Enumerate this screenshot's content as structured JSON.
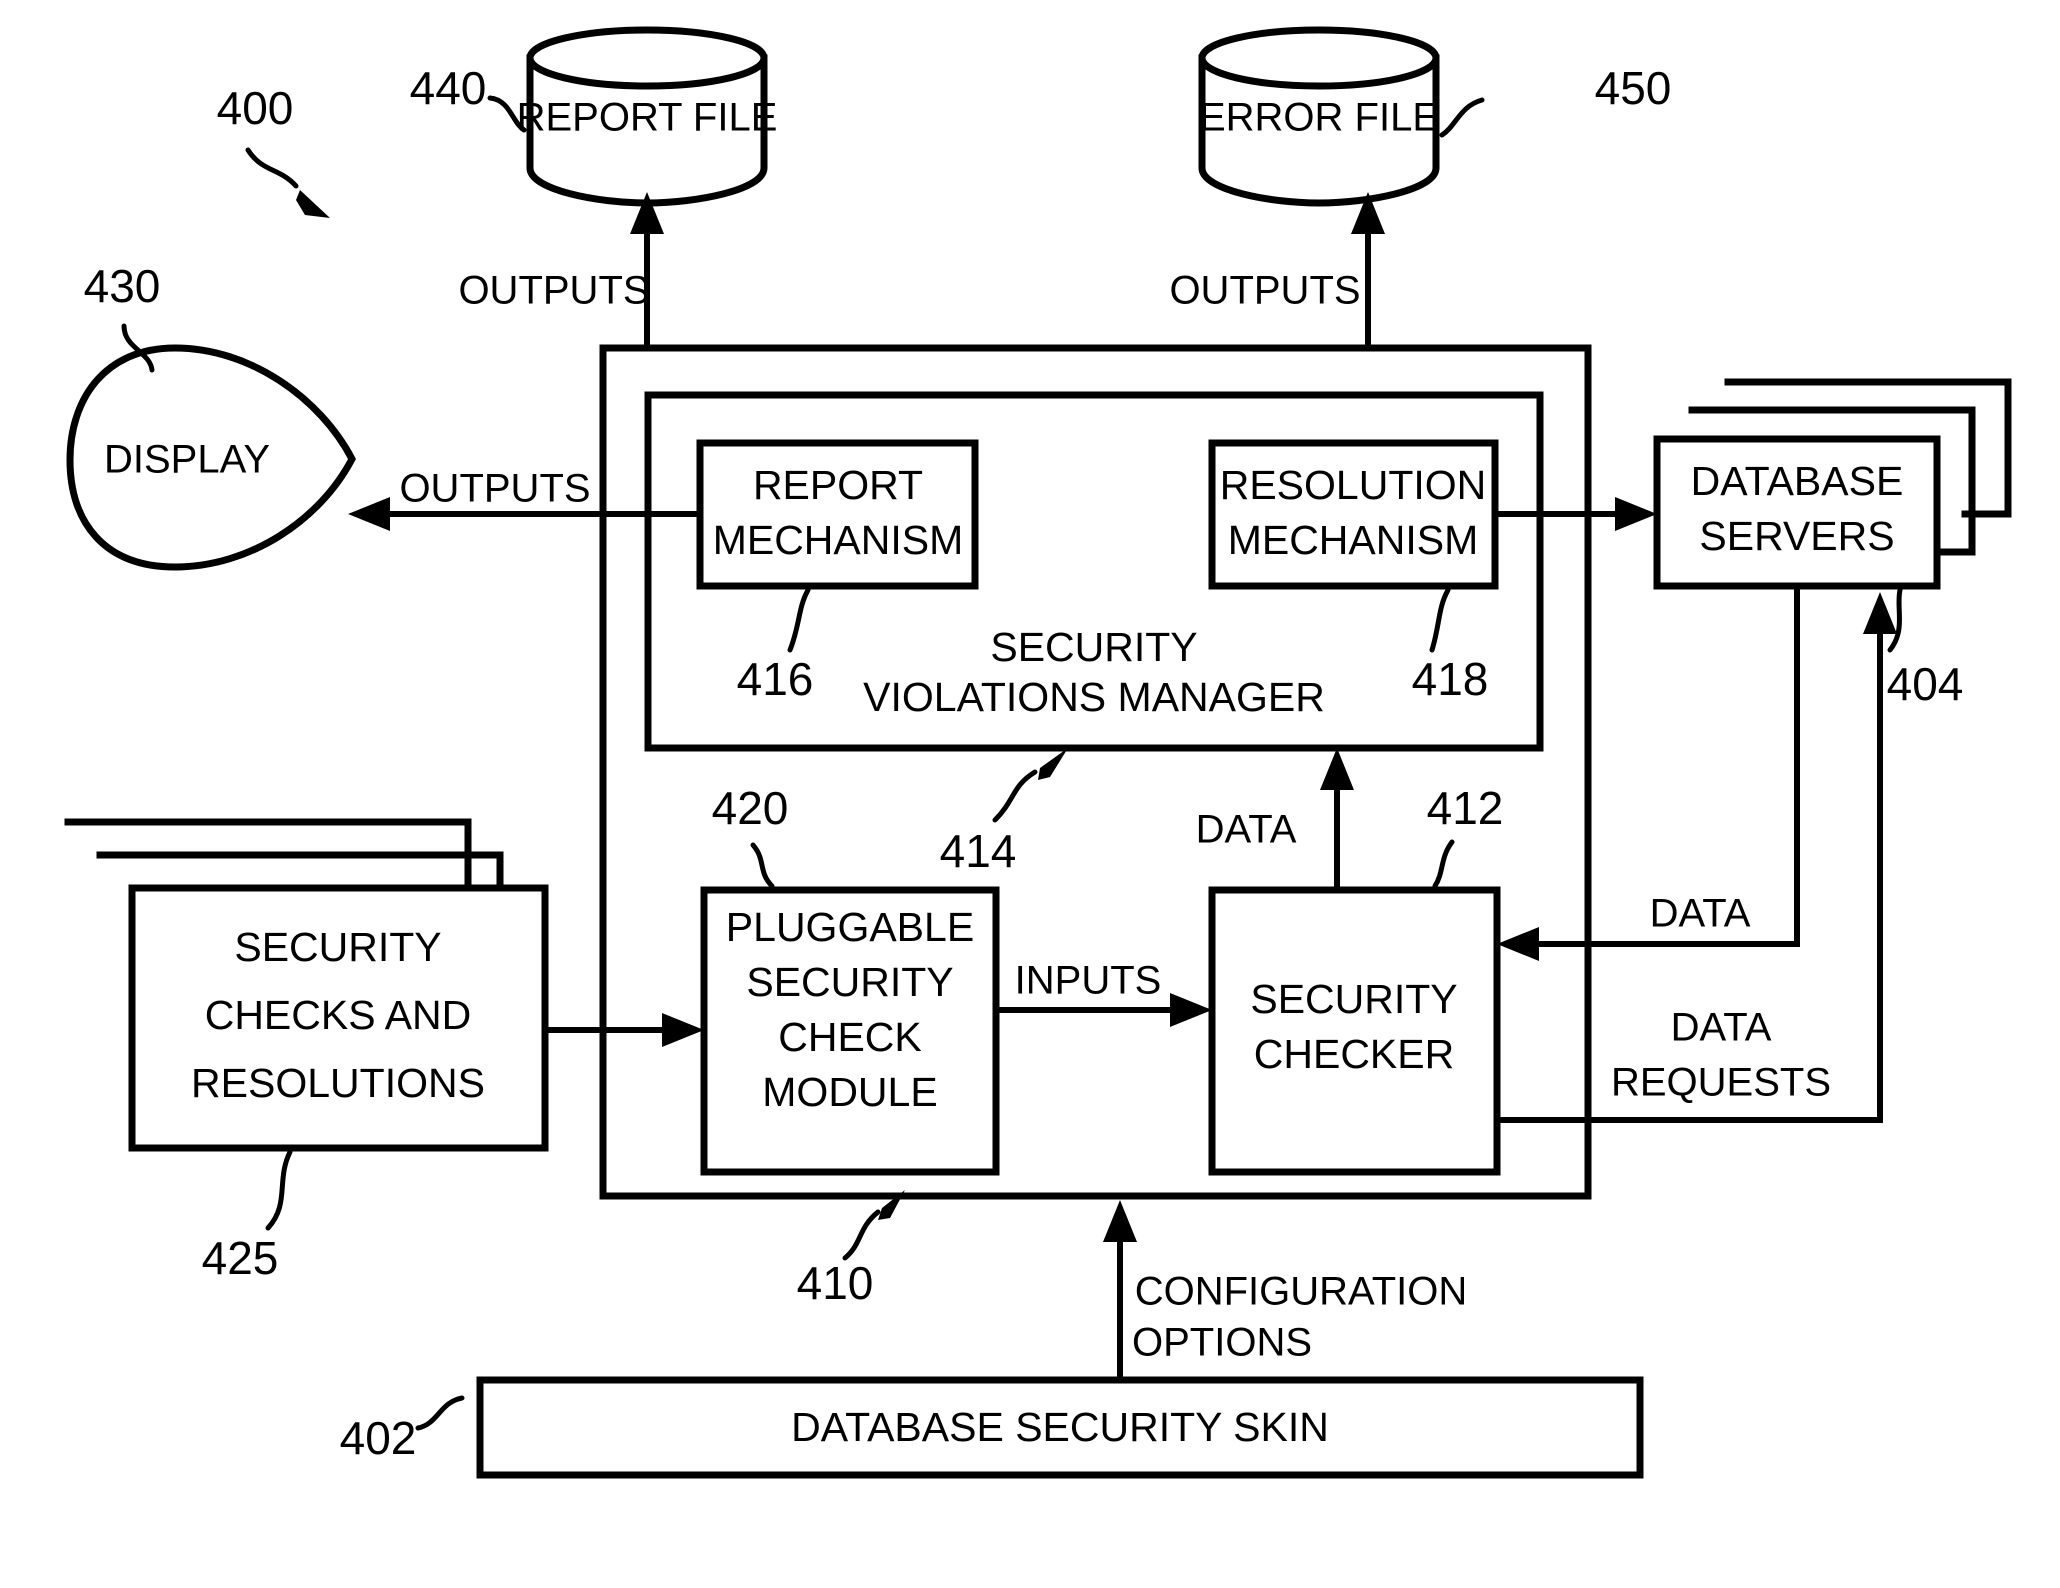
{
  "figure": {
    "reference_numeral": "400",
    "title": "Database Security Skin System Block Diagram"
  },
  "nodes": {
    "report_file": {
      "label": "REPORT FILE",
      "ref": "440",
      "shape": "cylinder"
    },
    "error_file": {
      "label": "ERROR FILE",
      "ref": "450",
      "shape": "cylinder"
    },
    "display": {
      "label": "DISPLAY",
      "ref": "430",
      "shape": "leaf"
    },
    "database_servers": {
      "label_line1": "DATABASE",
      "label_line2": "SERVERS",
      "ref": "404",
      "shape": "stacked-box"
    },
    "security_checks": {
      "label_line1": "SECURITY",
      "label_line2": "CHECKS AND",
      "label_line3": "RESOLUTIONS",
      "ref": "425",
      "shape": "stacked-box"
    },
    "report_mechanism": {
      "label_line1": "REPORT",
      "label_line2": "MECHANISM",
      "ref": "416",
      "shape": "box"
    },
    "resolution_mechanism": {
      "label_line1": "RESOLUTION",
      "label_line2": "MECHANISM",
      "ref": "418",
      "shape": "box"
    },
    "security_violations_manager": {
      "label_line1": "SECURITY",
      "label_line2": "VIOLATIONS MANAGER",
      "ref": "414",
      "shape": "box"
    },
    "pluggable_security_check_module": {
      "label_line1": "PLUGGABLE",
      "label_line2": "SECURITY",
      "label_line3": "CHECK",
      "label_line4": "MODULE",
      "ref": "420",
      "shape": "box"
    },
    "security_checker": {
      "label_line1": "SECURITY",
      "label_line2": "CHECKER",
      "ref": "412",
      "shape": "box"
    },
    "outer_container": {
      "ref": "410",
      "shape": "box"
    },
    "database_security_skin": {
      "label": "DATABASE SECURITY SKIN",
      "ref": "402",
      "shape": "box"
    }
  },
  "edge_labels": {
    "outputs_report": "OUTPUTS",
    "outputs_error": "OUTPUTS",
    "outputs_display": "OUTPUTS",
    "inputs": "INPUTS",
    "data_up": "DATA",
    "data_right": "DATA",
    "data_requests": "DATA REQUESTS",
    "data_requests_line1": "DATA",
    "data_requests_line2": "REQUESTS",
    "configuration_options_line1": "CONFIGURATION",
    "configuration_options_line2": "OPTIONS"
  },
  "refs": {
    "r400": "400",
    "r402": "402",
    "r404": "404",
    "r410": "410",
    "r412": "412",
    "r414": "414",
    "r416": "416",
    "r418": "418",
    "r420": "420",
    "r425": "425",
    "r430": "430",
    "r440": "440",
    "r450": "450"
  },
  "colors": {
    "stroke": "#000000",
    "background": "#ffffff"
  }
}
